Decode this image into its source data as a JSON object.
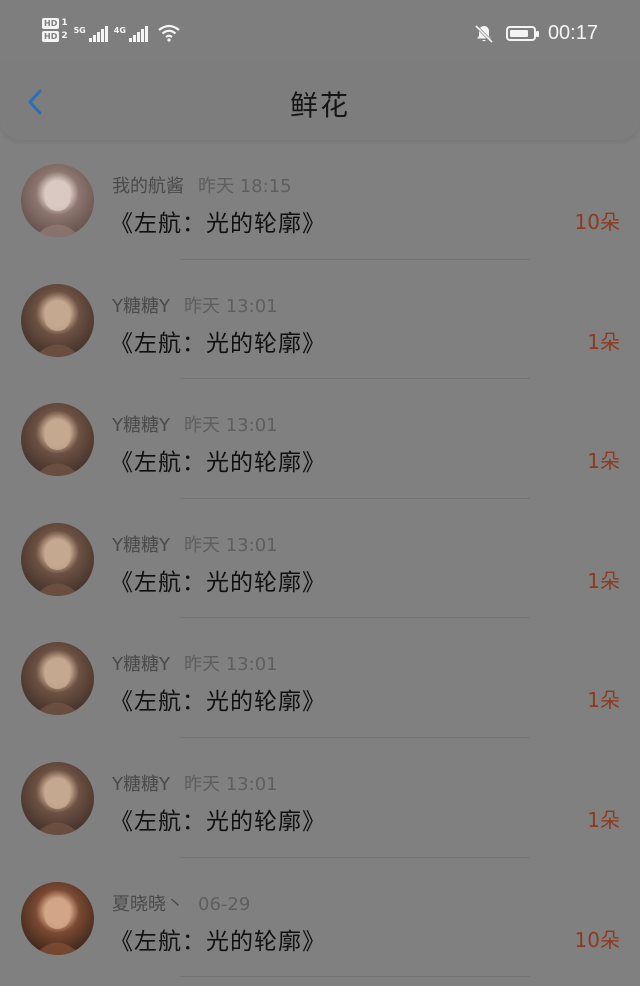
{
  "status_bar": {
    "hd1": "HD",
    "hd1_sub": "1",
    "hd2": "HD",
    "hd2_sub": "2",
    "net1": "5G",
    "net2": "4G",
    "time": "00:17",
    "icons": [
      "signal-icon",
      "wifi-icon",
      "bell-muted-icon",
      "battery-icon"
    ]
  },
  "header": {
    "title": "鲜花",
    "back_icon": "chevron-left-icon",
    "accent_color": "#2a6fb8"
  },
  "colors": {
    "count_color": "#8d3a1e"
  },
  "records": [
    {
      "name": "我的航酱",
      "time": "昨天 18:15",
      "book": "《左航：光的轮廓》",
      "count": "10朵",
      "avatar": "avatar-photo"
    },
    {
      "name": "Y糖糖Y",
      "time": "昨天 13:01",
      "book": "《左航：光的轮廓》",
      "count": "1朵",
      "avatar": "avatar-photo"
    },
    {
      "name": "Y糖糖Y",
      "time": "昨天 13:01",
      "book": "《左航：光的轮廓》",
      "count": "1朵",
      "avatar": "avatar-photo"
    },
    {
      "name": "Y糖糖Y",
      "time": "昨天 13:01",
      "book": "《左航：光的轮廓》",
      "count": "1朵",
      "avatar": "avatar-photo"
    },
    {
      "name": "Y糖糖Y",
      "time": "昨天 13:01",
      "book": "《左航：光的轮廓》",
      "count": "1朵",
      "avatar": "avatar-photo"
    },
    {
      "name": "Y糖糖Y",
      "time": "昨天 13:01",
      "book": "《左航：光的轮廓》",
      "count": "1朵",
      "avatar": "avatar-photo"
    },
    {
      "name": "夏晓晓丶",
      "time": "06-29",
      "book": "《左航：光的轮廓》",
      "count": "10朵",
      "avatar": "avatar-photo"
    }
  ]
}
